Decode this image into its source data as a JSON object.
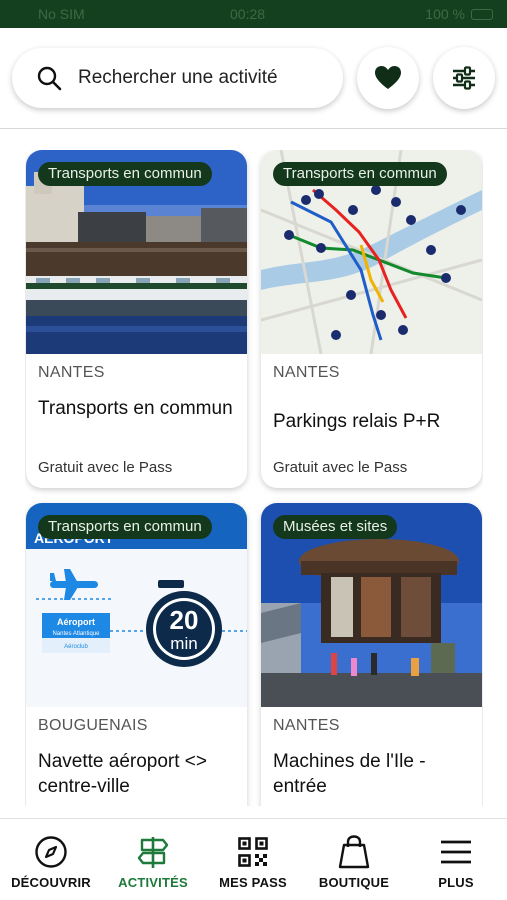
{
  "status_bar": {
    "carrier": "No SIM",
    "time": "00:28",
    "battery": "100 %"
  },
  "search": {
    "placeholder": "Rechercher une activité"
  },
  "cards": [
    {
      "tag": "Transports en commun",
      "city": "NANTES",
      "title": "Transports en commun",
      "price": "Gratuit avec le Pass"
    },
    {
      "tag": "Transports en commun",
      "city": "NANTES",
      "title": "Parkings relais P+R",
      "price": "Gratuit avec le Pass"
    },
    {
      "tag": "Transports en commun",
      "city": "BOUGUENAIS",
      "title": "Navette aéroport <> centre-ville",
      "price": "",
      "image_text": {
        "top": "AEROPORT",
        "airport_line1": "Aéroport",
        "airport_line2": "Nantes Atlantique",
        "airport_line3": "Aéroclub",
        "clock_number": "20",
        "clock_unit": "min"
      }
    },
    {
      "tag": "Musées et sites",
      "city": "NANTES",
      "title": "Machines de l'Ile - entrée",
      "price": ""
    }
  ],
  "tabs": [
    {
      "label": "DÉCOUVRIR",
      "icon": "compass-icon",
      "active": false
    },
    {
      "label": "ACTIVITÉS",
      "icon": "signpost-icon",
      "active": true
    },
    {
      "label": "MES PASS",
      "icon": "qr-code-icon",
      "active": false
    },
    {
      "label": "BOUTIQUE",
      "icon": "shopping-bag-icon",
      "active": false
    },
    {
      "label": "PLUS",
      "icon": "menu-icon",
      "active": false
    }
  ],
  "colors": {
    "accent": "#1d7a3a",
    "tag_bg": "#14381b",
    "status_bar_bg": "#15401f"
  }
}
